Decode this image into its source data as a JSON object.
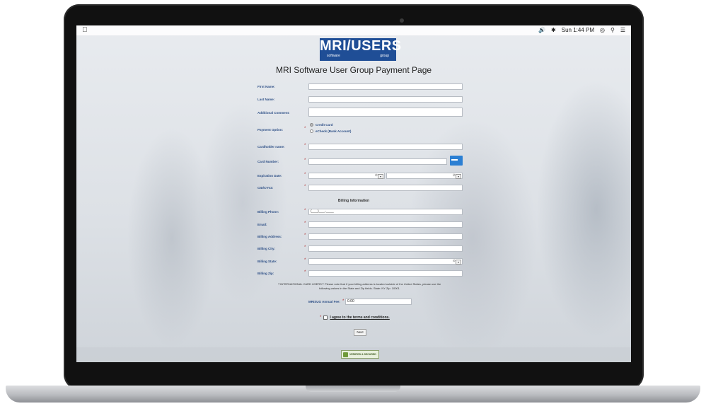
{
  "menubar": {
    "clock": "Sun 1:44 PM",
    "icons": [
      "apple-icon",
      "volume-icon",
      "bluetooth-icon",
      "wifi-icon",
      "search-icon",
      "list-icon"
    ]
  },
  "logo": {
    "main": "MRI/USERS",
    "left_small": "software",
    "right_small": "group"
  },
  "page_title": "MRI Software User Group Payment Page",
  "form": {
    "first_name": {
      "label": "First Name:",
      "value": ""
    },
    "last_name": {
      "label": "Last Name:",
      "value": ""
    },
    "additional_comment": {
      "label": "Additional Comment:",
      "value": ""
    },
    "payment_option": {
      "label": "Payment Option:",
      "options": [
        "Credit Card",
        "eCheck (Bank Account)"
      ],
      "selected": "Credit Card"
    },
    "cardholder_name": {
      "label": "Cardholder name:",
      "value": ""
    },
    "card_number": {
      "label": "Card Number:",
      "value": ""
    },
    "expiration_date": {
      "label": "Expiration Date:",
      "month": "",
      "year": ""
    },
    "cvv": {
      "label": "CID/CVV2:",
      "value": ""
    }
  },
  "billing": {
    "heading": "Billing Information",
    "phone": {
      "label": "Billing Phone:",
      "placeholder": "(___)___-____"
    },
    "email": {
      "label": "Email:",
      "value": ""
    },
    "address": {
      "label": "Billing Address:",
      "value": ""
    },
    "city": {
      "label": "Billing City:",
      "value": ""
    },
    "state": {
      "label": "Billing State:",
      "value": ""
    },
    "zip": {
      "label": "Billing Zip:",
      "value": ""
    }
  },
  "intl_note": {
    "line1": "**INTERNATIONAL CARD USERS** Please note that if your billing address is located outside of the United States, please use the",
    "line2": "following values in the State and Zip fields. State: NY Zip: 10001"
  },
  "fee": {
    "label": "MRISUG Annual Fee:",
    "value": "0.00"
  },
  "terms": {
    "label": "I agree to the terms and conditions."
  },
  "next_label": "Next",
  "badge_text": "VERIFIED & SECURED",
  "colors": {
    "logo_bg": "#1f4e96",
    "label": "#2d4f86",
    "required": "#b03030"
  }
}
